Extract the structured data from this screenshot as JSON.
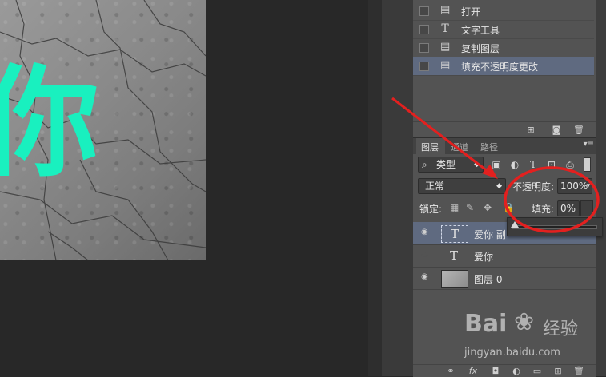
{
  "canvas": {
    "glyph": "你",
    "glyph_color": "#19f0bf"
  },
  "history": {
    "items": [
      {
        "icon": "doc-icon",
        "label": "打开",
        "selected": false
      },
      {
        "icon": "text-tool-icon",
        "label": "文字工具",
        "selected": false
      },
      {
        "icon": "doc-icon",
        "label": "复制图层",
        "selected": false
      },
      {
        "icon": "doc-icon",
        "label": "填充不透明度更改",
        "selected": true
      }
    ]
  },
  "layers_panel": {
    "tabs": [
      "图层",
      "通道",
      "路径"
    ],
    "filter": {
      "label": "类型"
    },
    "blend_mode": "正常",
    "opacity_label": "不透明度:",
    "opacity_value": "100%",
    "lock_label": "锁定:",
    "fill_label": "填充:",
    "fill_value": "0%",
    "fill_fraction": 0.0,
    "layers": [
      {
        "type": "text",
        "thumb": "T",
        "name": "爱你 副",
        "visible": true,
        "selected": true
      },
      {
        "type": "text",
        "thumb": "T",
        "name": "爱你",
        "visible": false,
        "selected": false
      },
      {
        "type": "image",
        "thumb": "",
        "name": "图层 0",
        "visible": true,
        "selected": false
      }
    ]
  },
  "watermark": {
    "brand": "Bai",
    "brand_suffix": "经验",
    "url": "jingyan.baidu.com"
  },
  "annotation_colors": {
    "arrow": "#e3201f",
    "ellipse": "#e3201f"
  }
}
